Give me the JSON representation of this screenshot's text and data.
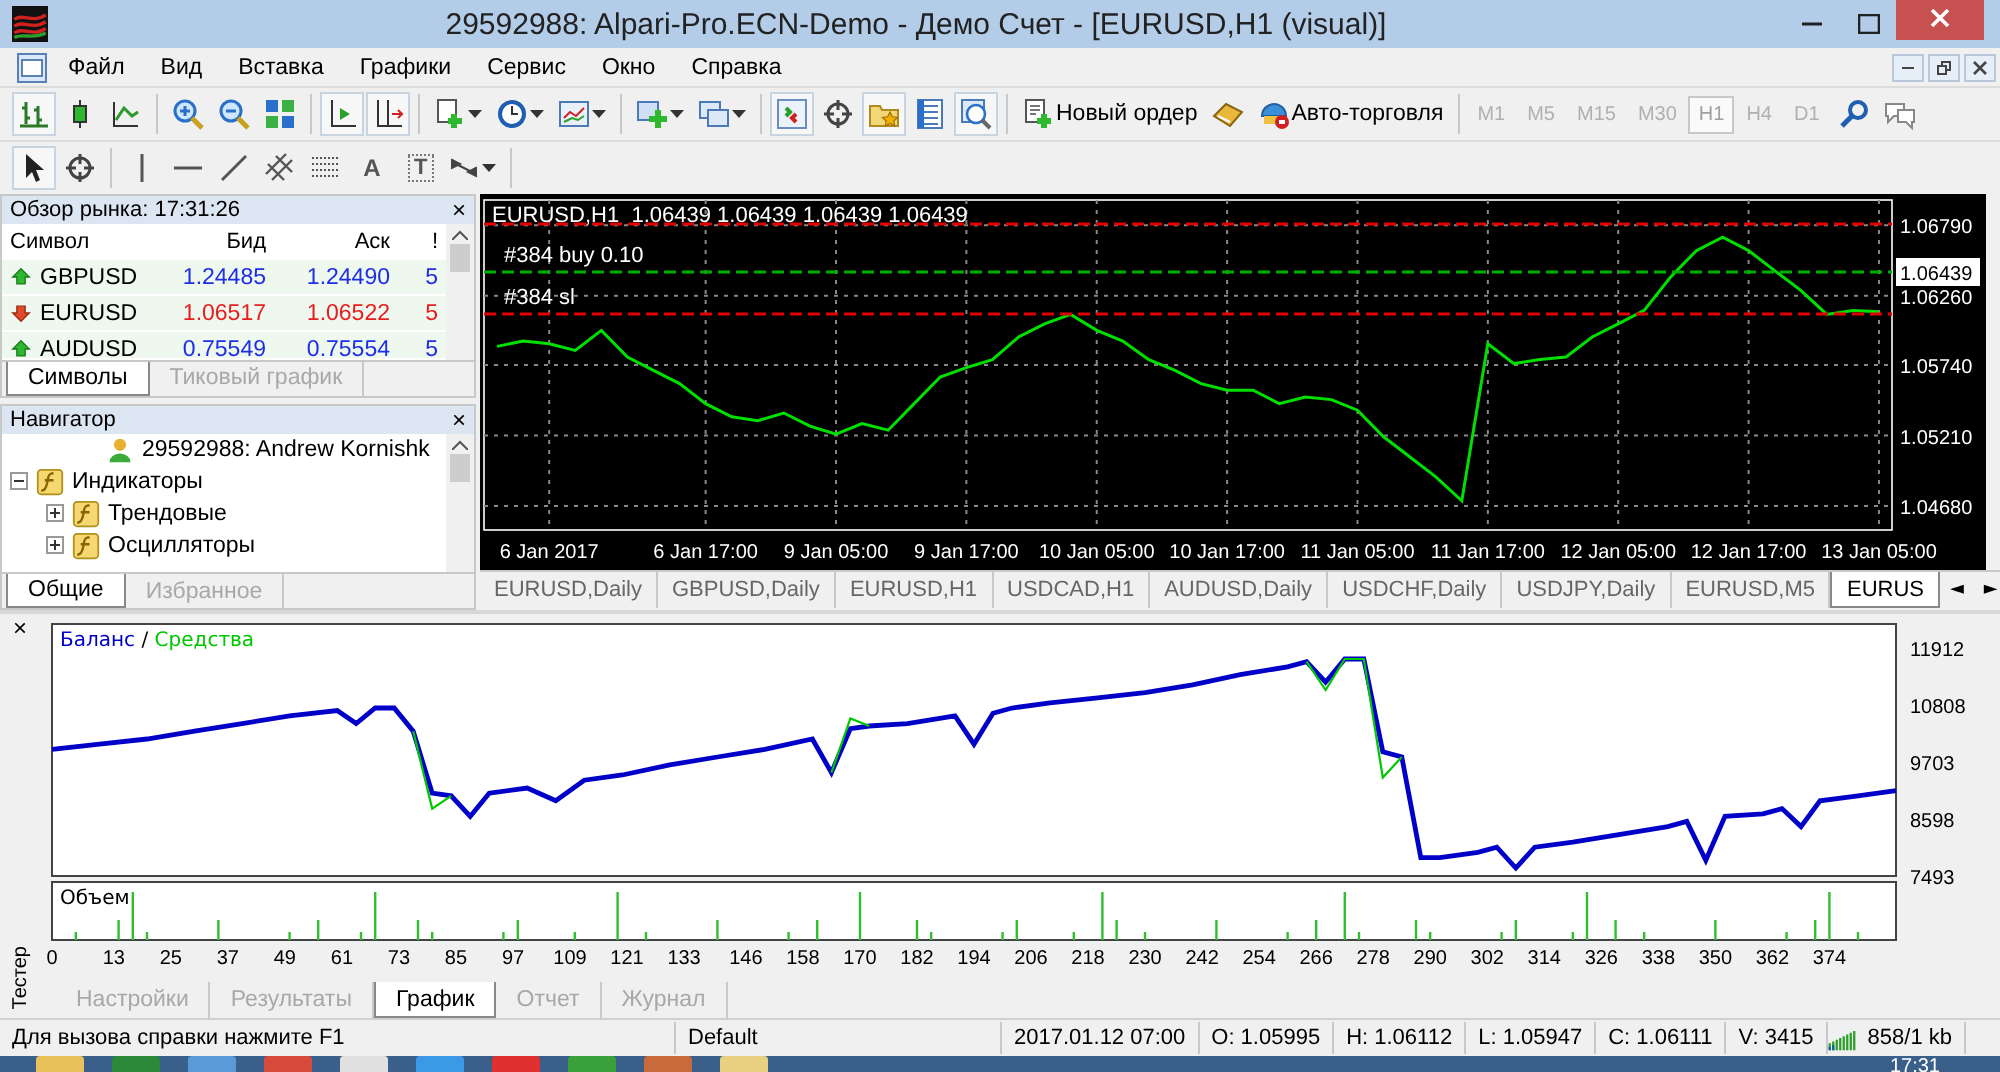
{
  "window": {
    "title": "29592988: Alpari-Pro.ECN-Demo - Демо Счет - [EURUSD,H1 (visual)]"
  },
  "menu": [
    "Файл",
    "Вид",
    "Вставка",
    "Графики",
    "Сервис",
    "Окно",
    "Справка"
  ],
  "toolbar": {
    "new_order": "Новый ордер",
    "auto_trading": "Авто-торговля",
    "text_tool": "A",
    "label_tool": "T"
  },
  "timeframes": [
    {
      "label": "M1",
      "selected": false
    },
    {
      "label": "M5",
      "selected": false
    },
    {
      "label": "M15",
      "selected": false
    },
    {
      "label": "M30",
      "selected": false
    },
    {
      "label": "H1",
      "selected": true
    },
    {
      "label": "H4",
      "selected": false
    },
    {
      "label": "D1",
      "selected": false
    }
  ],
  "market_watch": {
    "title": "Обзор рынка: 17:31:26",
    "close": "×",
    "columns": [
      "Символ",
      "Бид",
      "Аск",
      "!"
    ],
    "rows": [
      {
        "symbol": "GBPUSD",
        "bid": "1.24485",
        "ask": "1.24490",
        "spread": "5",
        "rising": true
      },
      {
        "symbol": "EURUSD",
        "bid": "1.06517",
        "ask": "1.06522",
        "spread": "5",
        "rising": false
      },
      {
        "symbol": "AUDUSD",
        "bid": "0.75549",
        "ask": "0.75554",
        "spread": "5",
        "rising": true
      }
    ],
    "tabs": [
      {
        "label": "Символы",
        "selected": true
      },
      {
        "label": "Тиковый график",
        "selected": false
      }
    ]
  },
  "navigator": {
    "title": "Навигатор",
    "close": "×",
    "items": [
      {
        "label": "29592988: Andrew Kornishk",
        "kind": "account"
      },
      {
        "label": "Индикаторы",
        "kind": "folder",
        "expanded": true,
        "children": [
          {
            "label": "Трендовые",
            "kind": "folder",
            "expanded": false
          },
          {
            "label": "Осцилляторы",
            "kind": "folder",
            "expanded": false
          }
        ]
      }
    ],
    "tabs": [
      {
        "label": "Общие",
        "selected": true
      },
      {
        "label": "Избранное",
        "selected": false
      }
    ]
  },
  "price_chart": {
    "header_values": "1.06439 1.06439 1.06439 1.06439",
    "price_label": "1.06439",
    "order_lines": [
      {
        "kind": "take_profit"
      },
      {
        "kind": "entry",
        "label": "#384 buy 0.10"
      },
      {
        "kind": "stop_loss",
        "label": "#384 sl"
      }
    ],
    "chart_data": {
      "type": "line",
      "categories": [
        null,
        null,
        "6 Jan 2017",
        null,
        null,
        null,
        null,
        null,
        "6 Jan 17:00",
        null,
        null,
        null,
        null,
        "9 Jan 05:00",
        null,
        null,
        null,
        null,
        "9 Jan 17:00",
        null,
        null,
        null,
        null,
        "10 Jan 05:00",
        null,
        null,
        null,
        null,
        "10 Jan 17:00",
        null,
        null,
        null,
        null,
        "11 Jan 05:00",
        null,
        null,
        null,
        null,
        "11 Jan 17:00",
        null,
        null,
        null,
        null,
        "12 Jan 05:00",
        null,
        null,
        null,
        null,
        "12 Jan 17:00",
        null,
        null,
        null,
        null,
        "13 Jan 05:00"
      ],
      "series": [
        {
          "name": "EURUSD,H1",
          "color": "#00e000",
          "values": [
            1.0588,
            1.0592,
            1.059,
            1.0585,
            1.06,
            1.058,
            1.057,
            1.056,
            1.0545,
            1.0535,
            1.0532,
            1.0538,
            1.0528,
            1.0522,
            1.053,
            1.0525,
            1.0545,
            1.0565,
            1.0572,
            1.0578,
            1.0595,
            1.0605,
            1.0612,
            1.06,
            1.0592,
            1.0578,
            1.057,
            1.056,
            1.0555,
            1.0555,
            1.0545,
            1.055,
            1.0548,
            1.054,
            1.052,
            1.0505,
            1.049,
            1.0472,
            1.059,
            1.0575,
            1.0578,
            1.058,
            1.0595,
            1.0605,
            1.0615,
            1.064,
            1.066,
            1.067,
            1.066,
            1.0645,
            1.063,
            1.0612,
            1.0615,
            1.0614
          ]
        }
      ],
      "ylim": [
        1.045,
        1.0698
      ],
      "yticks": [
        {
          "value": 1.0679,
          "label": "1.06790"
        },
        {
          "value": 1.0626,
          "label": "1.06260"
        },
        {
          "value": 1.0574,
          "label": "1.05740"
        },
        {
          "value": 1.0521,
          "label": "1.05210"
        },
        {
          "value": 1.0468,
          "label": "1.04680"
        }
      ],
      "grid": true
    },
    "tabs": [
      {
        "label": "EURUSD,Daily",
        "selected": false
      },
      {
        "label": "GBPUSD,Daily",
        "selected": false
      },
      {
        "label": "EURUSD,H1",
        "selected": false
      },
      {
        "label": "USDCAD,H1",
        "selected": false
      },
      {
        "label": "AUDUSD,Daily",
        "selected": false
      },
      {
        "label": "USDCHF,Daily",
        "selected": false
      },
      {
        "label": "USDJPY,Daily",
        "selected": false
      },
      {
        "label": "EURUSD,M5",
        "selected": false
      },
      {
        "label": "EURUS",
        "selected": true
      }
    ],
    "scroll_left": "◄",
    "scroll_right": "►"
  },
  "tester": {
    "side_label": "Тестер",
    "close": "×",
    "legend_separator": "/",
    "volume_label": "Объем",
    "chart_data": {
      "type": "line",
      "x": [
        0,
        10,
        20,
        30,
        40,
        50,
        60,
        64,
        68,
        72,
        76,
        80,
        84,
        88,
        92,
        100,
        106,
        112,
        120,
        130,
        140,
        150,
        160,
        164,
        168,
        172,
        180,
        190,
        194,
        198,
        202,
        210,
        220,
        230,
        240,
        250,
        260,
        264,
        268,
        272,
        276,
        280,
        284,
        288,
        292,
        300,
        304,
        308,
        312,
        320,
        330,
        340,
        344,
        348,
        352,
        360,
        364,
        368,
        372,
        380,
        388
      ],
      "series": [
        {
          "name": "Баланс",
          "color": "#0000c8",
          "values": [
            9950,
            10050,
            10150,
            10300,
            10450,
            10600,
            10700,
            10450,
            10750,
            10750,
            10300,
            9100,
            9050,
            8650,
            9100,
            9200,
            8950,
            9350,
            9450,
            9650,
            9800,
            9950,
            10150,
            9500,
            10350,
            10400,
            10450,
            10600,
            10050,
            10650,
            10750,
            10850,
            10950,
            11050,
            11200,
            11400,
            11550,
            11650,
            11250,
            11700,
            11700,
            9900,
            9800,
            7850,
            7850,
            7950,
            8050,
            7650,
            8050,
            8150,
            8300,
            8450,
            8550,
            7800,
            8650,
            8700,
            8800,
            8450,
            8950,
            9050,
            9150
          ]
        },
        {
          "name": "Средства",
          "color": "#00c800",
          "values": [
            null,
            null,
            null,
            null,
            null,
            null,
            null,
            null,
            null,
            null,
            10300,
            8800,
            9050,
            null,
            null,
            null,
            null,
            null,
            null,
            null,
            null,
            null,
            null,
            9500,
            10550,
            10400,
            null,
            null,
            null,
            null,
            null,
            null,
            null,
            null,
            null,
            null,
            null,
            11650,
            11100,
            11700,
            11700,
            9400,
            9800,
            null,
            null,
            null,
            null,
            null,
            null,
            null,
            null,
            null,
            null,
            null,
            null,
            null,
            null,
            null,
            null,
            null,
            null
          ]
        }
      ],
      "xlim": [
        0,
        388
      ],
      "ylim": [
        7493,
        12380
      ],
      "xticks": [
        0,
        13,
        25,
        37,
        49,
        61,
        73,
        85,
        97,
        109,
        121,
        133,
        146,
        158,
        170,
        182,
        194,
        206,
        218,
        230,
        242,
        254,
        266,
        278,
        290,
        302,
        314,
        326,
        338,
        350,
        362,
        374
      ],
      "yticks": [
        11912,
        10808,
        9703,
        8598,
        7493
      ]
    },
    "tabs": [
      {
        "label": "Настройки",
        "selected": false
      },
      {
        "label": "Результаты",
        "selected": false
      },
      {
        "label": "График",
        "selected": true
      },
      {
        "label": "Отчет",
        "selected": false
      },
      {
        "label": "Журнал",
        "selected": false
      }
    ]
  },
  "status_bar": {
    "help": "Для вызова справки нажмите F1",
    "profile": "Default",
    "time": "2017.01.12 07:00",
    "open": "O: 1.05995",
    "high": "H: 1.06112",
    "low": "L: 1.05947",
    "close": "C: 1.06111",
    "volume": "V: 3415",
    "traffic": "858/1 kb"
  },
  "taskbar": {
    "clock": "17:31"
  }
}
